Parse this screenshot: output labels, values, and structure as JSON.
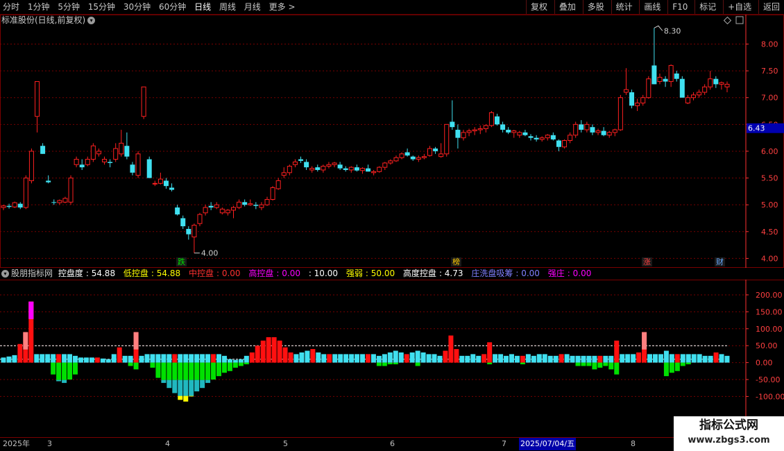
{
  "toolbar": {
    "periods": [
      "分时",
      "1分钟",
      "5分钟",
      "15分钟",
      "30分钟",
      "60分钟",
      "日线",
      "周线",
      "月线",
      "更多 >"
    ],
    "active_period": "日线",
    "tools": [
      "复权",
      "叠加",
      "多股",
      "统计",
      "画线",
      "F10",
      "标记",
      "+自选",
      "返回"
    ]
  },
  "stock": {
    "title": "标准股份(日线,前复权)",
    "high_label": "8.30",
    "low_label": "4.00",
    "current_price": "6.43"
  },
  "signals": [
    {
      "text": "跌",
      "color": "#00e000"
    },
    {
      "text": "榜",
      "color": "#ffcc00"
    },
    {
      "text": "涨",
      "color": "#ff4040"
    },
    {
      "text": "财",
      "color": "#66aaff"
    }
  ],
  "indicator": {
    "name": "股朋指标网",
    "items": [
      {
        "label": "控盘度",
        "value": "54.88",
        "color": "#ffffff"
      },
      {
        "label": "低控盘",
        "value": "54.88",
        "color": "#ffff00"
      },
      {
        "label": "中控盘",
        "value": "0.00",
        "color": "#ff3030"
      },
      {
        "label": "高控盘",
        "value": "0.00",
        "color": "#ff00ff"
      },
      {
        "label": "",
        "value": "10.00",
        "color": "#ffffff"
      },
      {
        "label": "强弱",
        "value": "50.00",
        "color": "#ffff00"
      },
      {
        "label": "高度控盘",
        "value": "4.73",
        "color": "#ffffff"
      },
      {
        "label": "庄洗盘吸筹",
        "value": "0.00",
        "color": "#8080ff"
      },
      {
        "label": "强庄",
        "value": "0.00",
        "color": "#ff00ff"
      }
    ]
  },
  "date_axis": {
    "year": "2025年",
    "months": [
      "3",
      "4",
      "5",
      "6",
      "7",
      "8"
    ],
    "cursor_date": "2025/07/04/五"
  },
  "watermark": {
    "title": "指标公式网",
    "url": "www.zbgs3.com"
  },
  "colors": {
    "up": "#ff2020",
    "down": "#40e0f0",
    "grid": "#7a0000",
    "axis": "#ff3030"
  },
  "chart_data": [
    {
      "type": "candlestick",
      "title": "标准股份(日线,前复权)",
      "ylim": [
        3.85,
        8.55
      ],
      "y_ticks": [
        "4.00",
        "4.50",
        "5.00",
        "5.50",
        "6.00",
        "6.50",
        "7.00",
        "7.50",
        "8.00"
      ],
      "x_months": [
        "3",
        "4",
        "5",
        "6",
        "7",
        "8"
      ],
      "ohlc": [
        [
          4.95,
          5.0,
          4.9,
          4.98
        ],
        [
          4.98,
          5.02,
          4.93,
          4.96
        ],
        [
          4.96,
          5.06,
          4.94,
          5.04
        ],
        [
          5.02,
          5.05,
          4.92,
          4.95
        ],
        [
          4.95,
          5.55,
          4.92,
          5.5
        ],
        [
          5.45,
          6.05,
          5.4,
          6.0
        ],
        [
          6.65,
          7.3,
          6.35,
          7.3
        ],
        [
          6.1,
          6.15,
          5.95,
          5.95
        ],
        [
          5.45,
          5.55,
          5.4,
          5.42
        ],
        [
          5.05,
          5.1,
          5.0,
          5.04
        ],
        [
          5.04,
          5.1,
          5.0,
          5.08
        ],
        [
          5.05,
          5.15,
          5.03,
          5.12
        ],
        [
          5.05,
          5.55,
          5.0,
          5.5
        ],
        [
          5.75,
          5.9,
          5.7,
          5.85
        ],
        [
          5.75,
          5.85,
          5.65,
          5.7
        ],
        [
          5.75,
          5.9,
          5.72,
          5.85
        ],
        [
          5.85,
          6.15,
          5.8,
          6.1
        ],
        [
          5.95,
          6.05,
          5.9,
          6.0
        ],
        [
          5.8,
          5.9,
          5.75,
          5.85
        ],
        [
          5.8,
          5.85,
          5.7,
          5.78
        ],
        [
          5.85,
          6.15,
          5.8,
          6.05
        ],
        [
          5.95,
          6.4,
          5.9,
          6.15
        ],
        [
          6.1,
          6.35,
          5.85,
          5.9
        ],
        [
          5.75,
          5.8,
          5.55,
          5.6
        ],
        [
          5.55,
          6.0,
          5.5,
          5.95
        ],
        [
          6.65,
          7.2,
          6.6,
          7.2
        ],
        [
          5.85,
          5.9,
          5.5,
          5.5
        ],
        [
          5.4,
          5.45,
          5.35,
          5.4
        ],
        [
          5.4,
          5.6,
          5.38,
          5.48
        ],
        [
          5.45,
          5.5,
          5.3,
          5.35
        ],
        [
          5.32,
          5.4,
          5.25,
          5.28
        ],
        [
          4.95,
          5.0,
          4.8,
          4.82
        ],
        [
          4.75,
          4.8,
          4.55,
          4.6
        ],
        [
          4.55,
          4.6,
          4.35,
          4.45
        ],
        [
          4.4,
          4.65,
          4.1,
          4.62
        ],
        [
          4.65,
          4.85,
          4.6,
          4.82
        ],
        [
          4.85,
          5.0,
          4.8,
          4.95
        ],
        [
          4.98,
          5.05,
          4.9,
          4.95
        ],
        [
          4.95,
          5.05,
          4.92,
          5.0
        ],
        [
          4.85,
          4.95,
          4.82,
          4.92
        ],
        [
          4.85,
          4.92,
          4.8,
          4.9
        ],
        [
          4.9,
          4.98,
          4.75,
          4.95
        ],
        [
          4.95,
          5.1,
          4.92,
          5.05
        ],
        [
          5.05,
          5.1,
          4.97,
          5.0
        ],
        [
          5.0,
          5.1,
          4.98,
          5.02
        ],
        [
          5.0,
          5.05,
          4.92,
          4.98
        ],
        [
          4.95,
          5.05,
          4.9,
          5.0
        ],
        [
          5.0,
          5.15,
          4.98,
          5.1
        ],
        [
          5.1,
          5.35,
          5.08,
          5.32
        ],
        [
          5.3,
          5.5,
          5.28,
          5.45
        ],
        [
          5.55,
          5.7,
          5.5,
          5.6
        ],
        [
          5.6,
          5.75,
          5.55,
          5.72
        ],
        [
          5.75,
          5.85,
          5.7,
          5.8
        ],
        [
          5.85,
          5.9,
          5.78,
          5.82
        ],
        [
          5.8,
          5.85,
          5.65,
          5.7
        ],
        [
          5.65,
          5.72,
          5.6,
          5.68
        ],
        [
          5.7,
          5.75,
          5.62,
          5.65
        ],
        [
          5.65,
          5.75,
          5.6,
          5.72
        ],
        [
          5.72,
          5.8,
          5.68,
          5.75
        ],
        [
          5.75,
          5.8,
          5.7,
          5.78
        ],
        [
          5.75,
          5.8,
          5.65,
          5.68
        ],
        [
          5.68,
          5.72,
          5.62,
          5.65
        ],
        [
          5.65,
          5.72,
          5.6,
          5.7
        ],
        [
          5.7,
          5.75,
          5.62,
          5.64
        ],
        [
          5.64,
          5.7,
          5.58,
          5.68
        ],
        [
          5.68,
          5.75,
          5.62,
          5.62
        ],
        [
          5.6,
          5.65,
          5.55,
          5.62
        ],
        [
          5.62,
          5.72,
          5.6,
          5.7
        ],
        [
          5.7,
          5.8,
          5.65,
          5.78
        ],
        [
          5.78,
          5.85,
          5.75,
          5.82
        ],
        [
          5.82,
          5.92,
          5.8,
          5.88
        ],
        [
          5.88,
          5.98,
          5.85,
          5.95
        ],
        [
          5.98,
          6.05,
          5.9,
          5.92
        ],
        [
          5.9,
          5.92,
          5.82,
          5.85
        ],
        [
          5.85,
          5.92,
          5.8,
          5.88
        ],
        [
          5.88,
          5.95,
          5.85,
          5.9
        ],
        [
          5.92,
          6.1,
          5.9,
          6.05
        ],
        [
          6.05,
          6.08,
          5.95,
          6.0
        ],
        [
          5.9,
          6.15,
          5.88,
          5.95
        ],
        [
          5.95,
          6.5,
          5.9,
          6.5
        ],
        [
          6.55,
          6.95,
          6.4,
          6.45
        ],
        [
          6.4,
          6.5,
          6.05,
          6.25
        ],
        [
          6.25,
          6.4,
          6.2,
          6.35
        ],
        [
          6.35,
          6.42,
          6.28,
          6.38
        ],
        [
          6.38,
          6.45,
          6.3,
          6.4
        ],
        [
          6.4,
          6.48,
          6.32,
          6.42
        ],
        [
          6.42,
          6.5,
          6.35,
          6.48
        ],
        [
          6.48,
          6.75,
          6.45,
          6.72
        ],
        [
          6.65,
          6.7,
          6.48,
          6.5
        ],
        [
          6.5,
          6.55,
          6.35,
          6.4
        ],
        [
          6.4,
          6.45,
          6.32,
          6.35
        ],
        [
          6.35,
          6.4,
          6.25,
          6.38
        ],
        [
          6.3,
          6.38,
          6.25,
          6.35
        ],
        [
          6.35,
          6.4,
          6.28,
          6.3
        ],
        [
          6.28,
          6.32,
          6.2,
          6.25
        ],
        [
          6.25,
          6.3,
          6.18,
          6.22
        ],
        [
          6.22,
          6.28,
          6.18,
          6.25
        ],
        [
          6.25,
          6.32,
          6.2,
          6.3
        ],
        [
          6.3,
          6.35,
          6.2,
          6.22
        ],
        [
          6.2,
          6.22,
          6.0,
          6.08
        ],
        [
          6.08,
          6.22,
          6.05,
          6.2
        ],
        [
          6.2,
          6.35,
          6.15,
          6.3
        ],
        [
          6.3,
          6.55,
          6.25,
          6.5
        ],
        [
          6.5,
          6.58,
          6.35,
          6.4
        ],
        [
          6.4,
          6.55,
          6.35,
          6.5
        ],
        [
          6.45,
          6.5,
          6.3,
          6.35
        ],
        [
          6.35,
          6.42,
          6.3,
          6.38
        ],
        [
          6.38,
          6.45,
          6.28,
          6.3
        ],
        [
          6.3,
          6.38,
          6.25,
          6.35
        ],
        [
          6.35,
          6.42,
          6.28,
          6.4
        ],
        [
          6.4,
          7.05,
          6.38,
          7.0
        ],
        [
          7.1,
          7.55,
          7.05,
          7.15
        ],
        [
          7.1,
          7.15,
          6.8,
          6.85
        ],
        [
          6.85,
          6.98,
          6.75,
          6.9
        ],
        [
          6.9,
          7.05,
          6.85,
          7.0
        ],
        [
          7.0,
          7.4,
          6.98,
          7.35
        ],
        [
          7.6,
          8.3,
          7.25,
          7.25
        ],
        [
          7.3,
          7.45,
          7.25,
          7.38
        ],
        [
          7.35,
          7.4,
          7.2,
          7.3
        ],
        [
          7.3,
          7.62,
          7.2,
          7.6
        ],
        [
          7.45,
          7.5,
          7.3,
          7.35
        ],
        [
          7.35,
          7.4,
          7.0,
          7.0
        ],
        [
          6.9,
          7.05,
          6.88,
          7.0
        ],
        [
          7.0,
          7.1,
          6.95,
          7.05
        ],
        [
          7.05,
          7.15,
          7.0,
          7.1
        ],
        [
          7.1,
          7.25,
          7.05,
          7.2
        ],
        [
          7.2,
          7.5,
          7.15,
          7.35
        ],
        [
          7.35,
          7.4,
          7.18,
          7.25
        ],
        [
          7.25,
          7.3,
          7.15,
          7.28
        ],
        [
          7.2,
          7.3,
          7.1,
          7.25
        ]
      ]
    },
    {
      "type": "bar",
      "title": "股朋指标网",
      "ylim": [
        -220,
        245
      ],
      "y_ticks": [
        "200.00",
        "150.00",
        "100.00",
        "50.00",
        "0.00",
        "-50.00",
        "-100.00"
      ],
      "reference_lines": [
        50,
        10
      ],
      "values": [
        15,
        18,
        22,
        55,
        90,
        180,
        25,
        25,
        25,
        25,
        25,
        25,
        25,
        20,
        15,
        15,
        15,
        15,
        12,
        10,
        25,
        45,
        20,
        20,
        90,
        20,
        25,
        25,
        25,
        25,
        25,
        25,
        25,
        25,
        25,
        25,
        25,
        25,
        25,
        25,
        20,
        10,
        8,
        10,
        20,
        30,
        50,
        65,
        75,
        75,
        65,
        45,
        30,
        25,
        30,
        35,
        40,
        30,
        25,
        25,
        25,
        25,
        25,
        25,
        25,
        25,
        25,
        25,
        20,
        25,
        30,
        35,
        30,
        25,
        30,
        35,
        30,
        25,
        25,
        20,
        35,
        80,
        40,
        20,
        20,
        25,
        20,
        25,
        60,
        25,
        25,
        20,
        25,
        20,
        20,
        25,
        20,
        25,
        25,
        20,
        20,
        25,
        25,
        20,
        20,
        20,
        20,
        20,
        20,
        20,
        20,
        65,
        25,
        25,
        25,
        30,
        90,
        25,
        25,
        25,
        35,
        25,
        25,
        25,
        25,
        25,
        25,
        20,
        20,
        30,
        25,
        20
      ],
      "lower_values": [
        0,
        0,
        0,
        0,
        0,
        0,
        0,
        0,
        0,
        -35,
        -55,
        -60,
        -50,
        -35,
        0,
        0,
        0,
        0,
        0,
        0,
        0,
        0,
        0,
        -10,
        -20,
        0,
        0,
        -15,
        -45,
        -60,
        -75,
        -90,
        -110,
        -115,
        -100,
        -85,
        -75,
        -60,
        -50,
        -40,
        -30,
        -25,
        -15,
        -10,
        -5,
        0,
        0,
        0,
        0,
        0,
        0,
        0,
        0,
        0,
        0,
        0,
        0,
        0,
        0,
        0,
        0,
        0,
        0,
        0,
        0,
        0,
        0,
        0,
        -10,
        -10,
        -5,
        -5,
        0,
        0,
        0,
        -10,
        0,
        0,
        0,
        0,
        0,
        0,
        0,
        0,
        0,
        0,
        0,
        0,
        -5,
        0,
        0,
        0,
        0,
        0,
        -5,
        0,
        0,
        0,
        0,
        0,
        0,
        0,
        0,
        0,
        -10,
        -10,
        -10,
        -20,
        -15,
        -10,
        -20,
        -35,
        0,
        0,
        0,
        0,
        0,
        0,
        0,
        0,
        -40,
        -30,
        -25,
        -10,
        -5,
        0,
        0,
        0,
        0,
        0,
        0,
        0
      ]
    }
  ]
}
